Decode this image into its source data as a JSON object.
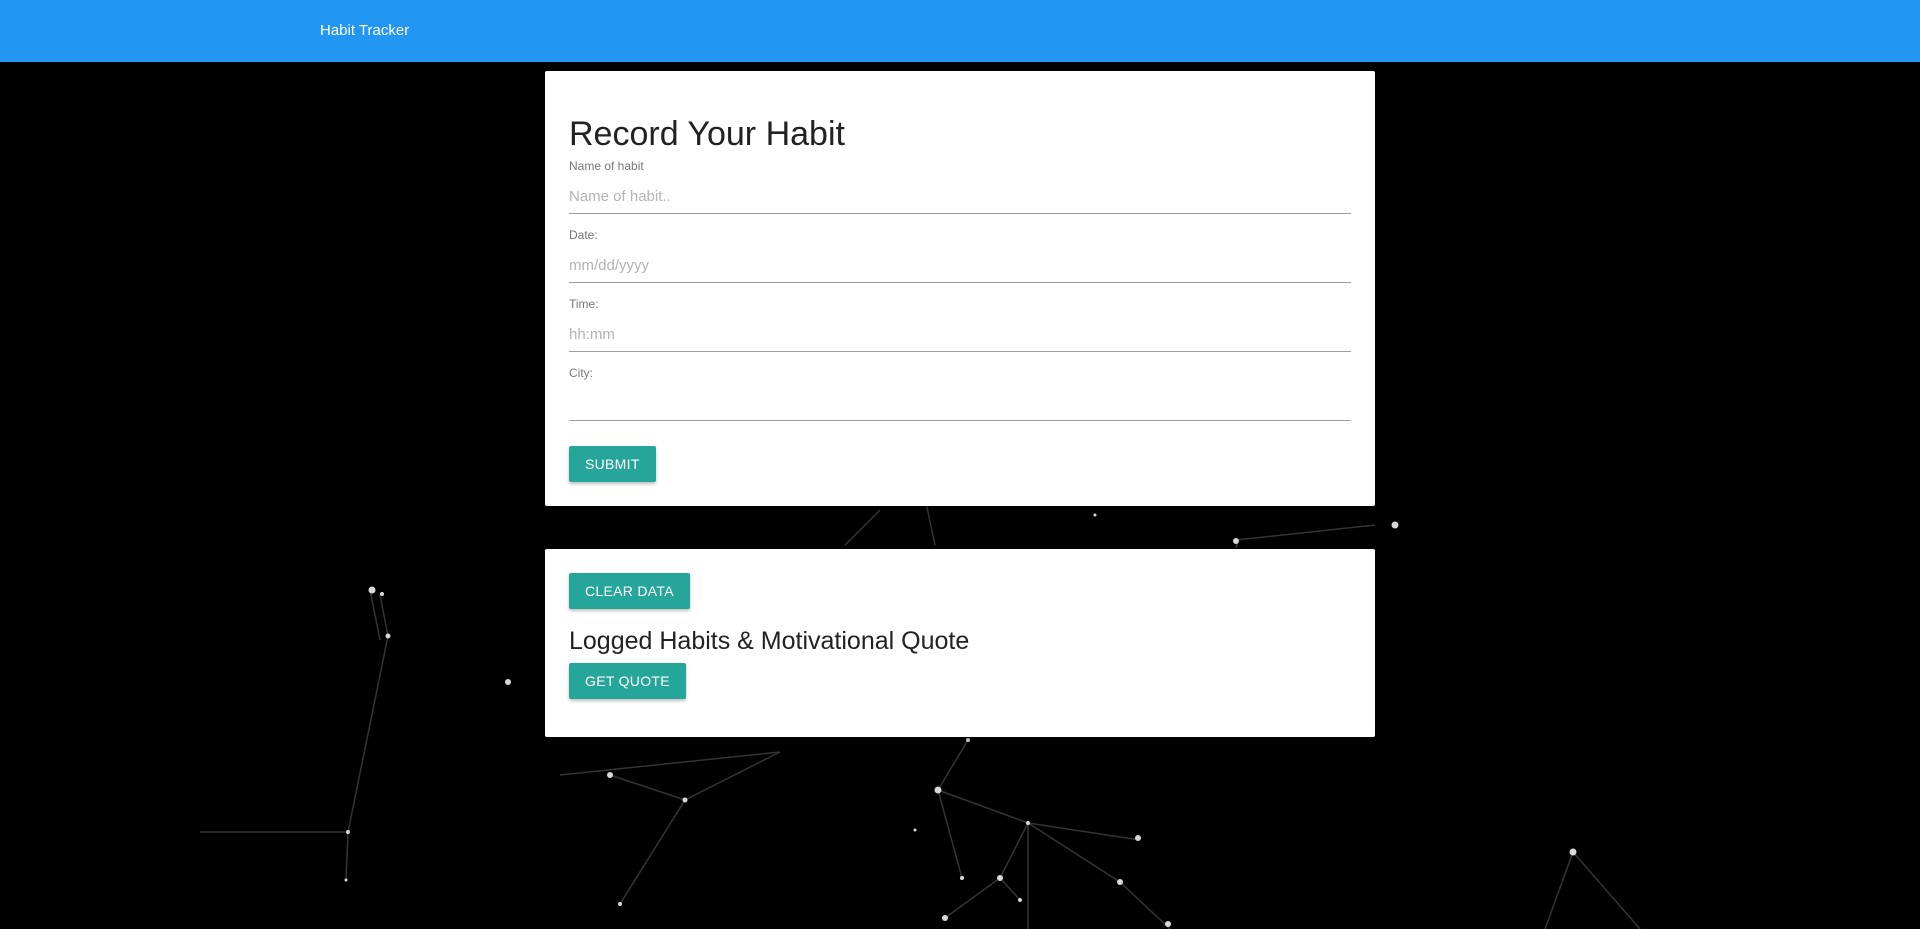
{
  "navbar": {
    "brand": "Habit Tracker"
  },
  "form": {
    "title": "Record Your Habit",
    "fields": [
      {
        "label": "Name of habit",
        "placeholder": "Name of habit..",
        "value": ""
      },
      {
        "label": "Date:",
        "placeholder": "mm/dd/yyyy",
        "value": ""
      },
      {
        "label": "Time:",
        "placeholder": "hh:mm",
        "value": ""
      },
      {
        "label": "City:",
        "placeholder": "",
        "value": ""
      }
    ],
    "submit_label": "SUBMIT"
  },
  "log": {
    "clear_label": "CLEAR DATA",
    "title": "Logged Habits & Motivational Quote",
    "quote_label": "GET QUOTE"
  },
  "colors": {
    "navbar": "#2196f3",
    "button": "#26a69a",
    "background": "#000000"
  }
}
